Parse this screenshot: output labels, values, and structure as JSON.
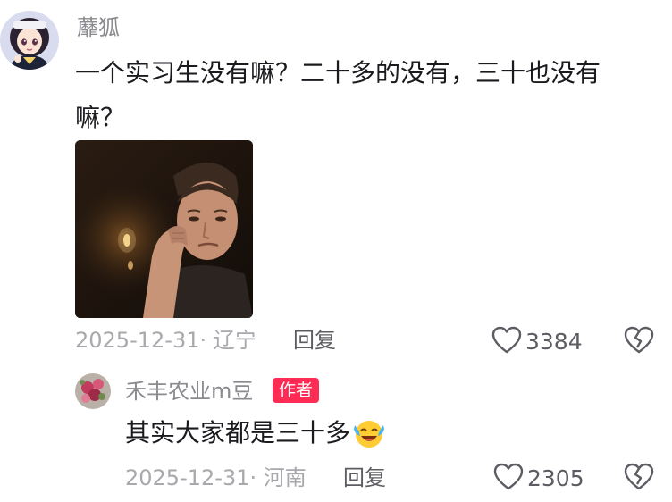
{
  "comment": {
    "username": "蘼狐",
    "text": "一个实习生没有嘛？二十多的没有，三十也没有嘛？",
    "date": "2025-12-31",
    "location": "· 辽宁",
    "reply_label": "回复",
    "like_count": "3384",
    "icons": {
      "like": "heart-outline-icon",
      "dislike": "broken-heart-icon"
    }
  },
  "reply": {
    "username": "禾丰农业m豆",
    "badge": "作者",
    "text": "其实大家都是三十多",
    "emoji": "crying-laughing-emoji",
    "date": "2025-12-31",
    "location": "· 河南",
    "reply_label": "回复",
    "like_count": "2305"
  },
  "colors": {
    "badge": "#fe2c55",
    "meta": "#a8a8ad",
    "text": "#1b1b1f"
  }
}
